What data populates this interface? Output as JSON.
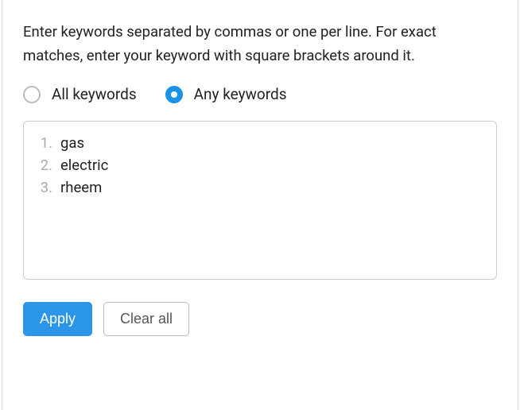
{
  "instructions": "Enter keywords separated by commas or one per line. For exact matches, enter your keyword with square brackets around it.",
  "radios": {
    "all_label": "All keywords",
    "any_label": "Any keywords",
    "selected": "any"
  },
  "keywords": {
    "lines": [
      "gas",
      "electric",
      "rheem"
    ]
  },
  "actions": {
    "apply_label": "Apply",
    "clear_label": "Clear all"
  }
}
